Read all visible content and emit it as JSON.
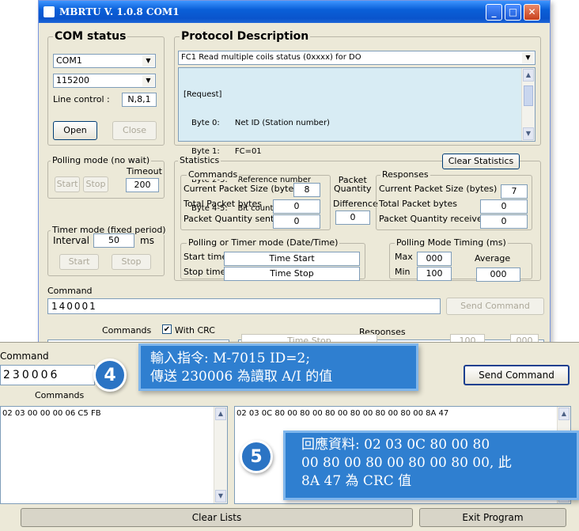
{
  "window": {
    "title": "MBRTU  V. 1.0.8  COM1"
  },
  "com_status": {
    "title": "COM status",
    "port": "COM1",
    "baud": "115200",
    "line_control_label": "Line control :",
    "line_control_value": "N,8,1",
    "open_label": "Open",
    "close_label": "Close"
  },
  "protocol": {
    "title": "Protocol Description",
    "selected": "FC1  Read multiple coils status (0xxxx)  for DO",
    "desc_lines": [
      "[Request]",
      "Byte 0:      Net ID (Station number)",
      "Byte 1:      FC=01",
      "Byte 2-3:    Reference number",
      "Byte 4-5:    Bit count"
    ]
  },
  "polling": {
    "title": "Polling mode (no wait)",
    "timeout_label": "Timeout",
    "timeout_value": "200",
    "start_label": "Start",
    "stop_label": "Stop"
  },
  "timer": {
    "title": "Timer mode (fixed period)",
    "interval_label": "Interval",
    "interval_value": "50",
    "unit": "ms",
    "start_label": "Start",
    "stop_label": "Stop"
  },
  "statistics": {
    "title": "Statistics",
    "clear_label": "Clear Statistics",
    "commands_title": "Commands",
    "cur_packet_label": "Current Packet Size (bytes)",
    "cur_packet_value": "8",
    "total_bytes_label": "Total Packet bytes",
    "total_bytes_value": "0",
    "sent_label": "Packet Quantity sent",
    "sent_value": "0",
    "packet_quantity_label": "Packet\nQuantity",
    "difference_label": "Difference",
    "difference_value": "0",
    "responses_title": "Responses",
    "resp_cur_label": "Current Packet Size (bytes)",
    "resp_cur_value": "7",
    "resp_total_label": "Total Packet bytes",
    "resp_total_value": "0",
    "received_label": "Packet Quantity received",
    "received_value": "0",
    "timer_title": "Polling  or Timer mode  (Date/Time)",
    "start_time_label": "Start time",
    "start_time_value": "Time Start",
    "stop_time_label": "Stop time",
    "stop_time_value": "Time Stop",
    "timing_title": "Polling Mode Timing (ms)",
    "max_label": "Max",
    "max_value": "000",
    "min_label": "Min",
    "min_value": "100",
    "average_label": "Average",
    "average_value": "000"
  },
  "command": {
    "label": "Command",
    "value": "140001",
    "send_label": "Send Command"
  },
  "list_headers": {
    "commands": "Commands",
    "with_crc": "With CRC",
    "responses": "Responses",
    "peek_time_stop": "Time Stop",
    "peek_100": "100",
    "peek_000": "000"
  },
  "bottom": {
    "command_label": "Command",
    "command_value": "230006",
    "send_label": "Send Command",
    "commands_header": "Commands",
    "commands_line": "02 03 00 00 00 06 C5 FB",
    "responses_line": "02 03 0C 80 00 80 00 80 00 80 00 80 00 80 00 8A 47",
    "clear_label": "Clear Lists",
    "exit_label": "Exit Program"
  },
  "callout4": {
    "badge": "4",
    "line1": "輸入指令: M-7015 ID=2;",
    "line2": "傳送 230006 為讀取 A/I 的值"
  },
  "callout5": {
    "badge": "5",
    "line1": "回應資料: 02 03 0C 80 00 80",
    "line2": "00 80 00 80 00 80 00 80 00, 此",
    "line3": "8A 47 為 CRC 值"
  },
  "colors": {
    "titlebar": "#0a54cc",
    "face": "#ece9d8",
    "callout": "#2f7fd0",
    "desc_bg": "#d8ecf4"
  }
}
